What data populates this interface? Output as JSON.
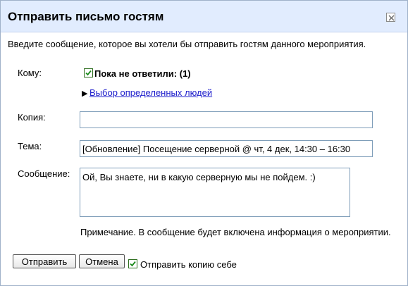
{
  "dialog": {
    "title": "Отправить письмо гостям",
    "intro": "Введите сообщение, которое вы хотели бы отправить гостям данного мероприятия."
  },
  "to": {
    "label": "Кому:",
    "recipient_checked": true,
    "recipient_label": "Пока не ответили: (1)",
    "select_people_link": "Выбор определенных людей"
  },
  "cc": {
    "label": "Копия:",
    "value": ""
  },
  "subject": {
    "label": "Тема:",
    "value": "[Обновление] Посещение серверной @ чт, 4 дек, 14:30 – 16:30"
  },
  "message": {
    "label": "Сообщение:",
    "value": "Ой, Вы знаете, ни в какую серверную мы не пойдем. :)"
  },
  "note": "Примечание. В сообщение будет включена информация о мероприятии.",
  "footer": {
    "send_label": "Отправить",
    "cancel_label": "Отмена",
    "send_copy_checked": true,
    "send_copy_label": "Отправить копию себе"
  }
}
